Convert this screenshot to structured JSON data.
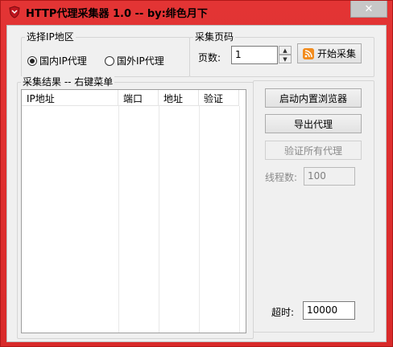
{
  "window": {
    "title": "HTTP代理采集器 1.0 -- by:绯色月下",
    "icons": {
      "app": "shield-icon",
      "close": "close-icon"
    },
    "colors": {
      "titlebar": "#e33434",
      "client_bg": "#f0f0f0",
      "rss_orange": "#f28c1e"
    }
  },
  "region_group": {
    "title": "选择IP地区",
    "options": [
      {
        "label": "国内IP代理",
        "selected": true
      },
      {
        "label": "国外IP代理",
        "selected": false
      }
    ]
  },
  "page_group": {
    "title": "采集页码",
    "pages_label": "页数:",
    "pages_value": "1",
    "start_button": "开始采集",
    "start_icon": "rss-icon"
  },
  "results_group": {
    "title": "采集结果 -- 右键菜单",
    "columns": [
      "IP地址",
      "端口",
      "地址",
      "验证"
    ]
  },
  "actions": {
    "browser_button": "启动内置浏览器",
    "export_button": "导出代理",
    "verify_button": "验证所有代理",
    "threads_label": "线程数:",
    "threads_value": "100",
    "timeout_label": "超时:",
    "timeout_value": "10000"
  }
}
